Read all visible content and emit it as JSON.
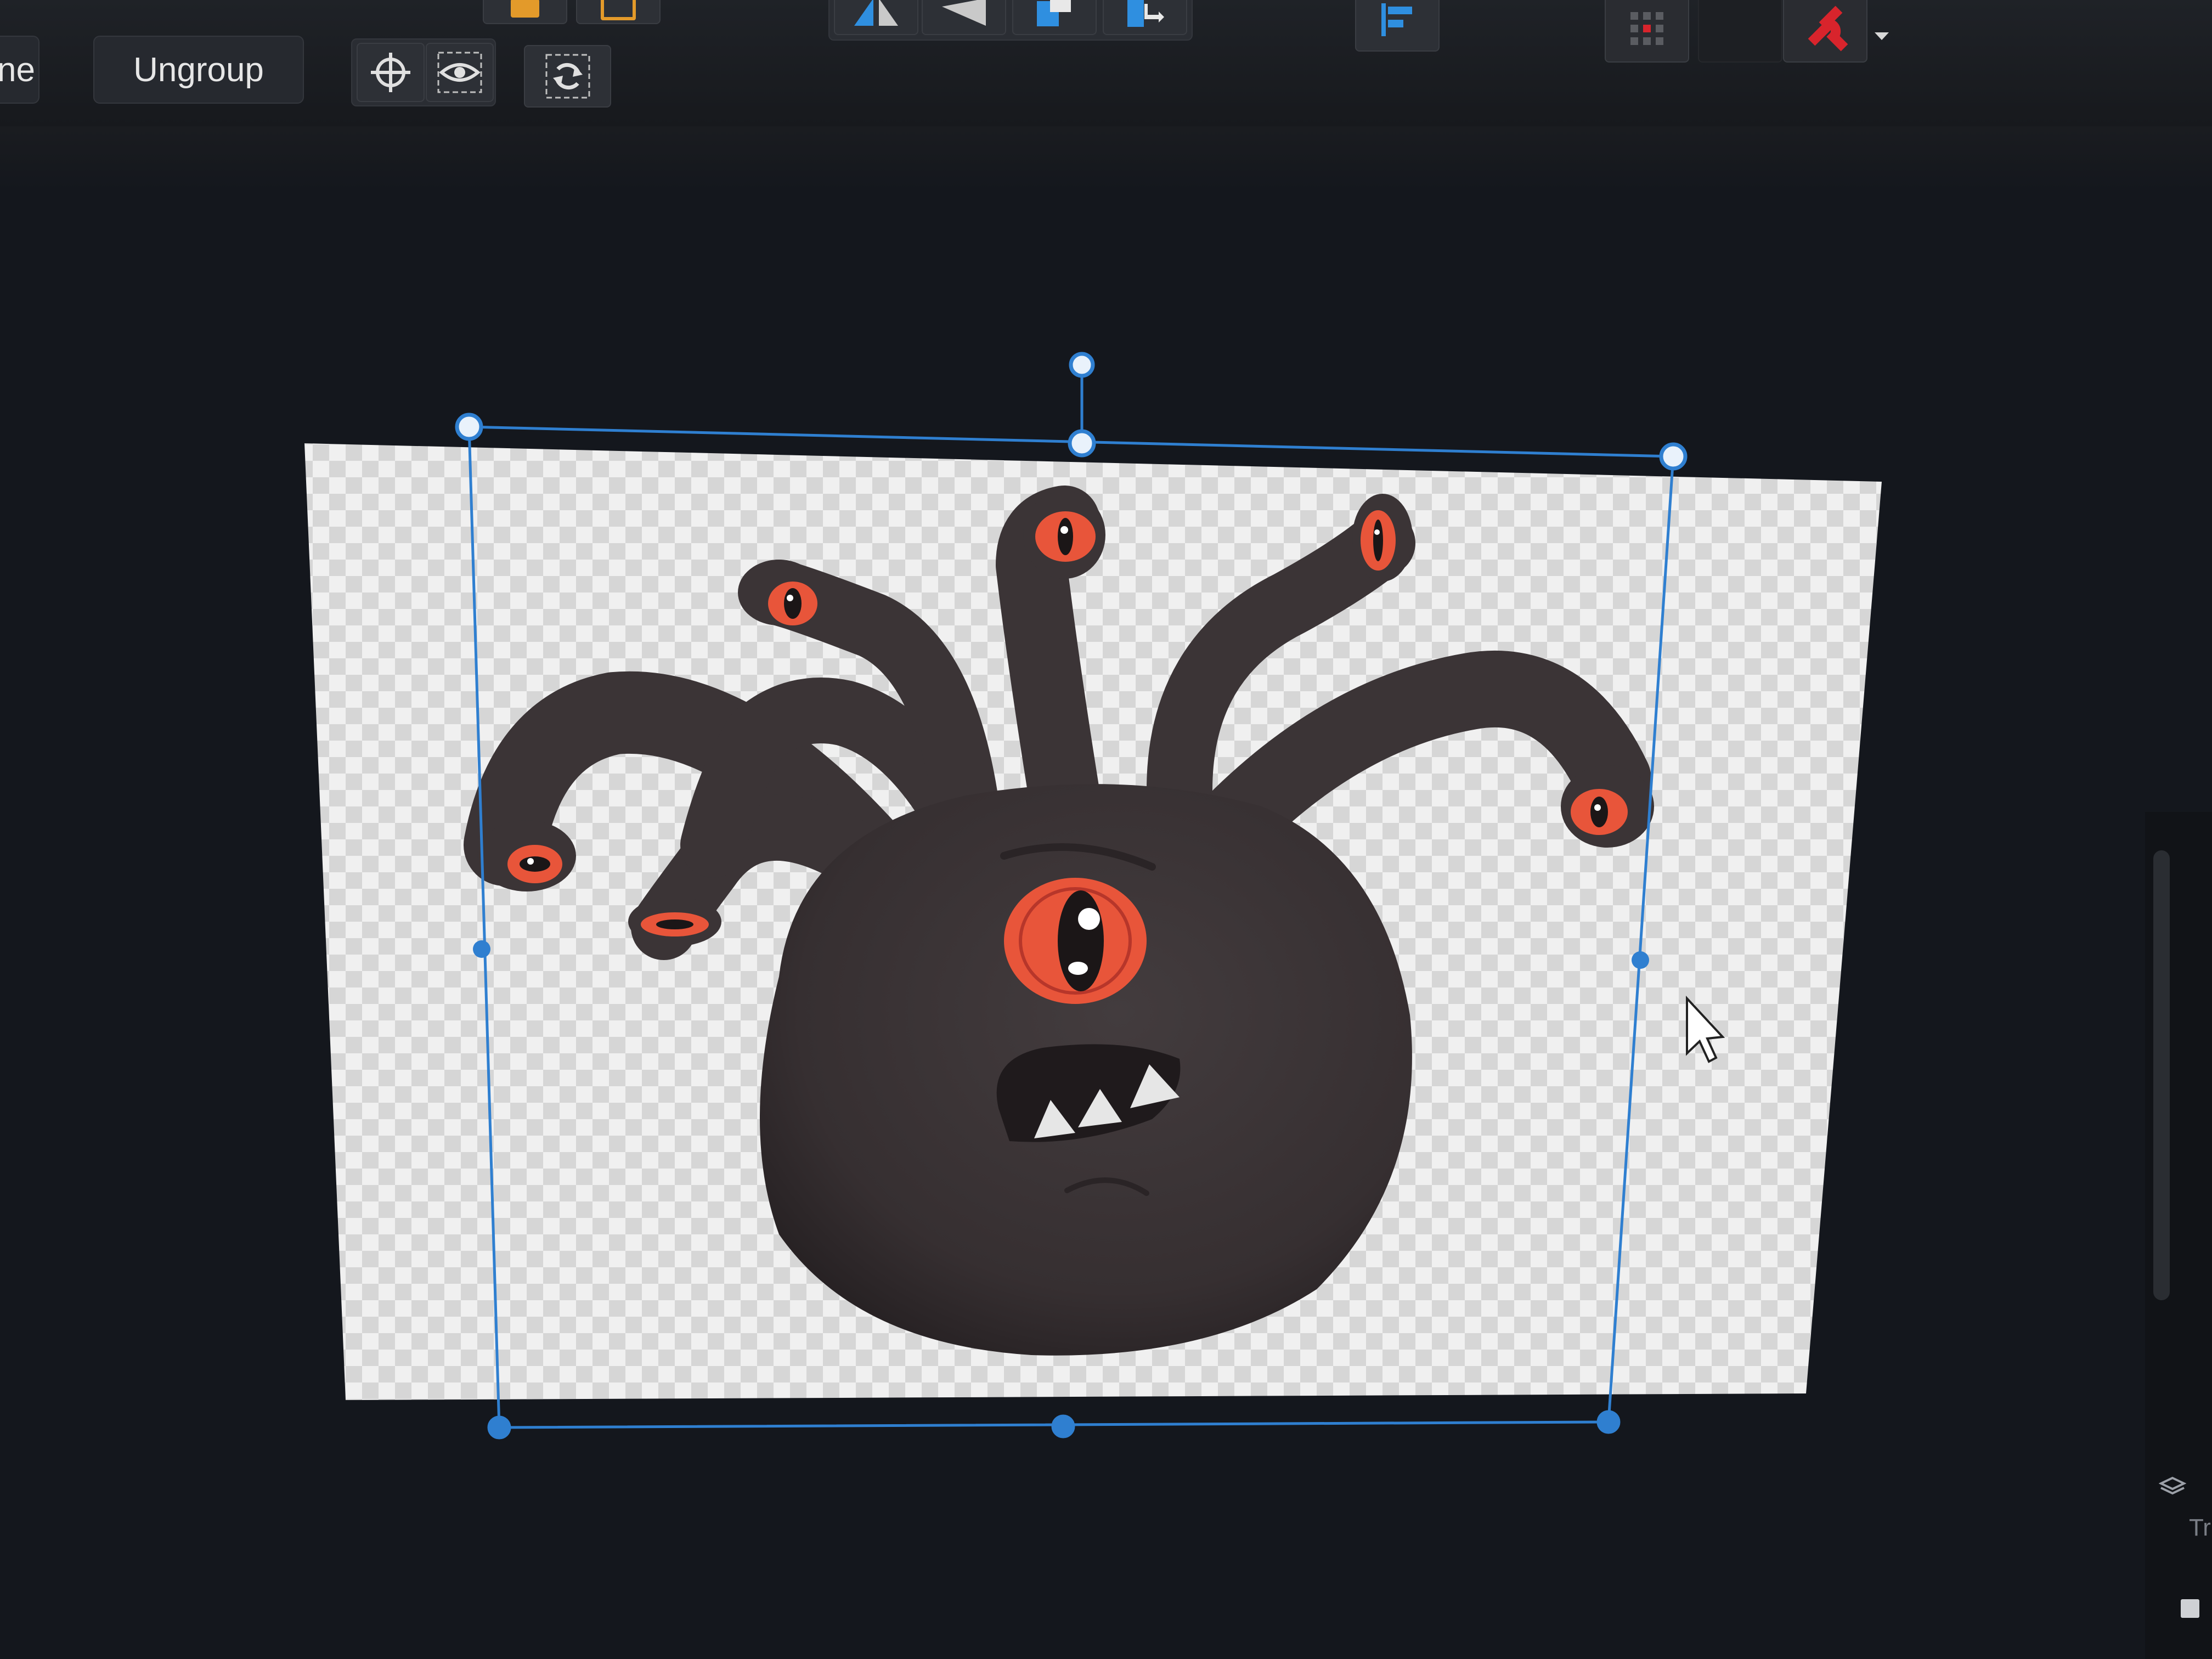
{
  "toolbar": {
    "partial_label": "ne",
    "ungroup_label": "Ungroup"
  },
  "right_panel": {
    "partial_label": "Tr"
  },
  "icons": {
    "target": "crosshair-icon",
    "visibility": "eye-icon",
    "reset": "refresh-icon",
    "flip_horizontal": "flip-horizontal-icon",
    "flip_vertical": "flip-vertical-icon",
    "arrange_front": "arrange-front-icon",
    "arrange_back": "arrange-back-icon",
    "align": "align-left-icon",
    "grid": "grid-icon",
    "snap": "magnet-icon",
    "dropdown": "chevron-down-icon",
    "cursor": "mouse-pointer-icon"
  },
  "colors": {
    "selection": "#2f7fd0",
    "creature": "#3a3436",
    "eye": "#e8553a",
    "magnet": "#d8242c",
    "accent_blue": "#2f8fe0",
    "accent_orange": "#e39a2a"
  }
}
